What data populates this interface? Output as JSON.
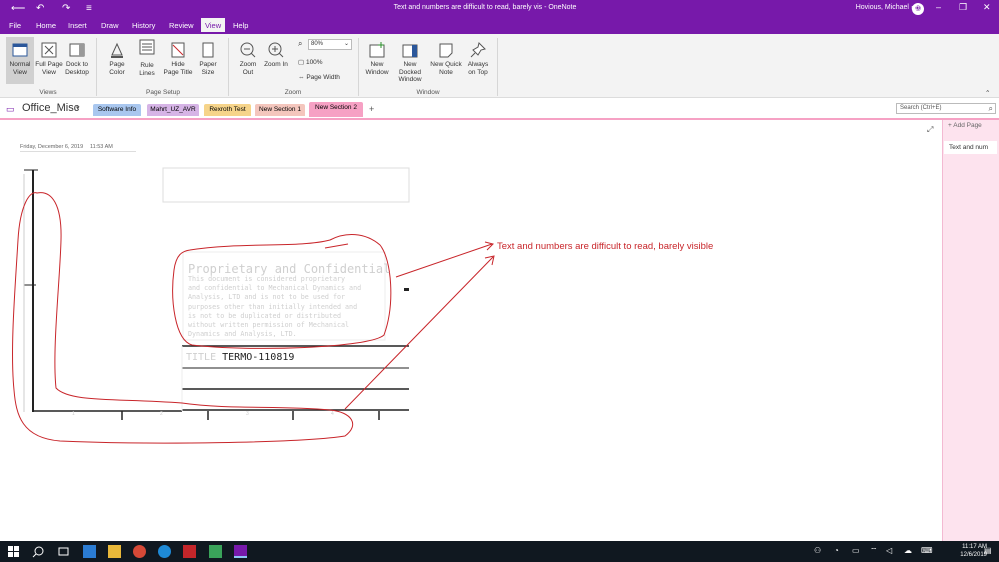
{
  "titlebar": {
    "title": "Text and numbers are difficult to read, barely vis  -  OneNote",
    "user": "Hovious, Michael"
  },
  "menu": [
    "File",
    "Home",
    "Insert",
    "Draw",
    "History",
    "Review",
    "View",
    "Help"
  ],
  "ribbon": {
    "views": {
      "normal_view": "Normal View",
      "full_page_view": "Full Page View",
      "dock_to_desktop": "Dock to Desktop",
      "label": "Views"
    },
    "page_setup": {
      "page_color": "Page Color",
      "rule_lines": "Rule Lines",
      "hide_page_title": "Hide Page Title",
      "paper_size": "Paper Size",
      "label": "Page Setup"
    },
    "zoom": {
      "zoom_out": "Zoom Out",
      "zoom_in": "Zoom In",
      "zoom_value": "80%",
      "hundred": "100%",
      "page_width": "Page Width",
      "label": "Zoom"
    },
    "window": {
      "new_window": "New Window",
      "new_docked_window": "New Docked Window",
      "new_quick_note": "New Quick Note",
      "always_on_top": "Always on Top",
      "label": "Window"
    }
  },
  "notebook": {
    "name": "Office_Misc",
    "sections": [
      {
        "label": "Software Info",
        "color": "#a9c7ef"
      },
      {
        "label": "Mahrt_UZ_AVR",
        "color": "#d6b4e6"
      },
      {
        "label": "Rexroth Test",
        "color": "#f6d48a"
      },
      {
        "label": "New Section 1",
        "color": "#f4c6bd"
      },
      {
        "label": "New Section 2",
        "color": "#f6a1c4"
      }
    ],
    "search_placeholder": "Search (Ctrl+E)"
  },
  "page": {
    "date": "Friday, December 6, 2019",
    "time": "11:53 AM",
    "annotation": "Text and numbers are difficult to read, barely visible",
    "drawing": {
      "block_title": "Proprietary and Confidential",
      "block_text": [
        "This document is considered proprietary",
        "and confidential to Mechanical Dynamics and",
        "Analysis, LTD and is not to be used for",
        "purposes other than initially intended and",
        "is not to be duplicated or distributed",
        "without written permission of Mechanical",
        "Dynamics and Analysis, LTD."
      ],
      "title_label": "TITLE",
      "title_value": "TERMO-110819",
      "ruler": [
        "1",
        "2",
        "3",
        "4"
      ]
    }
  },
  "sidebar": {
    "add_page": "Add Page",
    "page_item": "Text and num"
  },
  "taskbar": {
    "time": "11:17 AM",
    "date": "12/6/2019"
  },
  "colors": {
    "accent": "#7719aa",
    "ink": "#c8252a",
    "section_active": "#f6a1c4"
  }
}
